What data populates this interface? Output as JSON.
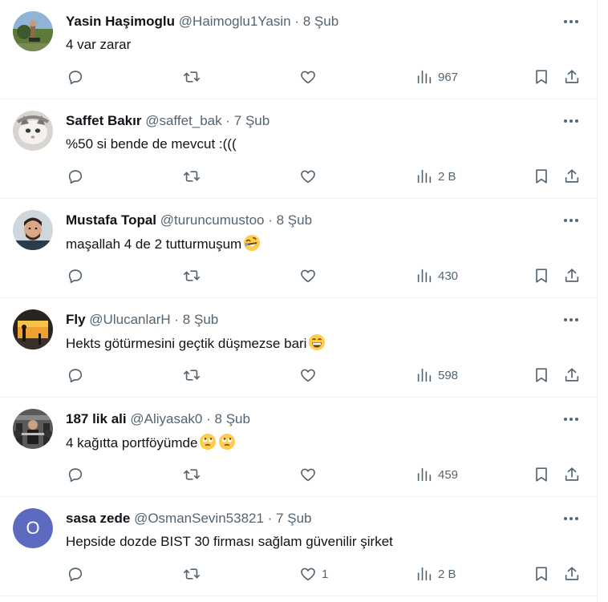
{
  "tweets": [
    {
      "name": "Yasin Haşimoglu",
      "handle": "@Haimoglu1Yasin",
      "dot": "·",
      "date": "8 Şub",
      "text": "4 var zarar",
      "emojis": [],
      "likes": "",
      "views": "967",
      "avatar": "photo-landscape"
    },
    {
      "name": "Saffet Bakır",
      "handle": "@saffet_bak",
      "dot": "·",
      "date": "7 Şub",
      "text": "%50 si bende de mevcut :(((",
      "emojis": [],
      "likes": "",
      "views": "2 B",
      "avatar": "photo-cat"
    },
    {
      "name": "Mustafa Topal",
      "handle": "@turuncumustoo",
      "dot": "·",
      "date": "8 Şub",
      "text": "maşallah 4 de 2 tutturmuşum",
      "emojis": [
        "rofl-emoji"
      ],
      "likes": "",
      "views": "430",
      "avatar": "photo-man"
    },
    {
      "name": "Fly",
      "handle": "@UlucanlarH",
      "dot": "·",
      "date": "8 Şub",
      "text": "Hekts götürmesini geçtik düşmezse bari",
      "emojis": [
        "grin-emoji"
      ],
      "likes": "",
      "views": "598",
      "avatar": "photo-sunset"
    },
    {
      "name": "187 lik ali",
      "handle": "@Aliyasak0",
      "dot": "·",
      "date": "8 Şub",
      "text": "4 kağıtta portföyümde",
      "emojis": [
        "eye-roll-emoji",
        "eye-roll-emoji"
      ],
      "likes": "",
      "views": "459",
      "avatar": "photo-gym"
    },
    {
      "name": "sasa zede",
      "handle": "@OsmanSevin53821",
      "dot": "·",
      "date": "7 Şub",
      "text": "Hepside dozde BIST 30 firması sağlam güvenilir şirket",
      "emojis": [],
      "likes": "1",
      "views": "2 B",
      "avatar": "letter",
      "avatar_letter": "O",
      "avatar_color": "#5c6bc0"
    }
  ],
  "colors": {
    "text_primary": "#0f1419",
    "text_secondary": "#536471",
    "divider": "#eff3f4"
  },
  "icons": [
    "reply-icon",
    "retweet-icon",
    "like-icon",
    "views-icon",
    "bookmark-icon",
    "share-icon",
    "more-icon"
  ]
}
